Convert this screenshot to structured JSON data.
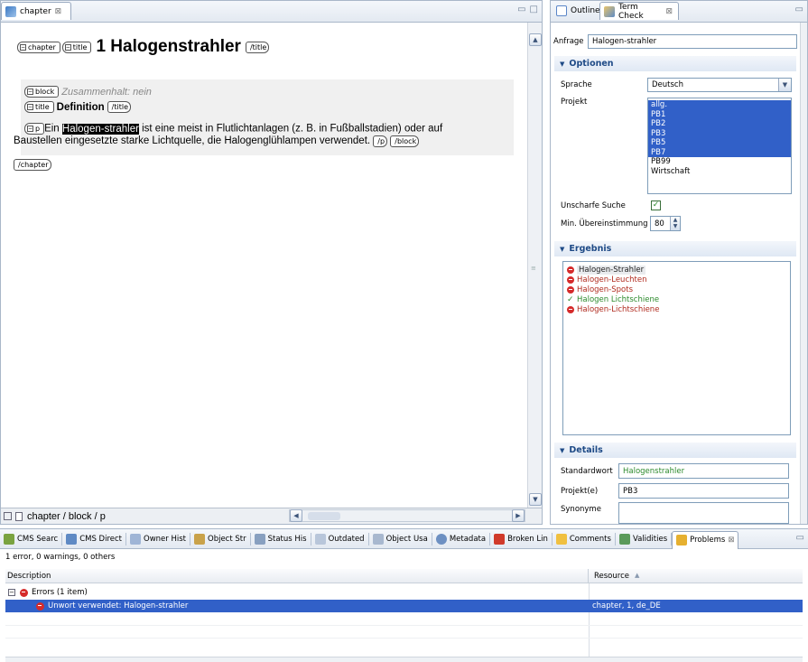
{
  "editor": {
    "tab_label": "chapter",
    "tab_close": "⊠",
    "tags": {
      "chapter": "chapter",
      "title": "title",
      "title_end": "/title",
      "block": "block",
      "p": "p",
      "p_end": "/p",
      "block_end": "/block",
      "chapter_end": "/chapter"
    },
    "heading": "1 Halogenstrahler",
    "meta_text": "Zusammenhalt: nein",
    "subheading": "Definition",
    "para_before": "Ein ",
    "para_highlight": "Halogen-strahler",
    "para_line1_after": " ist eine meist in Flutlichtanlagen (z. B. in Fußballstadien) oder auf",
    "para_line2": "Baustellen eingesetzte starke Lichtquelle, die Halogenglühlampen verwendet.",
    "breadcrumb": "chapter / block / p"
  },
  "side": {
    "tabs": [
      {
        "label": "Outline"
      },
      {
        "label": "Term Check"
      }
    ],
    "anfrage_label": "Anfrage",
    "anfrage_value": "Halogen-strahler",
    "optionen_title": "Optionen",
    "sprache_label": "Sprache",
    "sprache_value": "Deutsch",
    "projekt_label": "Projekt",
    "projekt_options": [
      "allg.",
      "PB1",
      "PB2",
      "PB3",
      "PB5",
      "PB7",
      "PB99",
      "Wirtschaft"
    ],
    "projekt_selected_count": 6,
    "unscharfe_label": "Unscharfe Suche",
    "unscharfe_checked": true,
    "min_label": "Min. Übereinstimmung",
    "min_value": "80",
    "ergebnis_title": "Ergebnis",
    "results": [
      {
        "label": "Halogen-Strahler",
        "status": "error"
      },
      {
        "label": "Halogen-Leuchten",
        "status": "error"
      },
      {
        "label": "Halogen-Spots",
        "status": "error"
      },
      {
        "label": "Halogen Lichtschiene",
        "status": "ok"
      },
      {
        "label": "Halogen-Lichtschiene",
        "status": "error"
      }
    ],
    "details_title": "Details",
    "standardwort_label": "Standardwort",
    "standardwort_value": "Halogenstrahler",
    "projekte_label": "Projekt(e)",
    "projekte_value": "PB3",
    "synonyme_label": "Synonyme",
    "colors": {
      "error": "#c0392b",
      "ok": "#2c8a2c",
      "selection": "#3160c8",
      "section": "#1e4a86"
    }
  },
  "problems": {
    "tabs": [
      "CMS Searc",
      "CMS Direct",
      "Owner Hist",
      "Object Str",
      "Status His",
      "Outdated",
      "Object Usa",
      "Metadata",
      "Broken Lin",
      "Comments",
      "Validities",
      "Problems"
    ],
    "summary": "1 error, 0 warnings, 0 others",
    "col_description": "Description",
    "col_resource": "Resource",
    "group_label": "Errors (1 item)",
    "error_description": "Unwort verwendet: Halogen-strahler",
    "error_resource": "chapter, 1, de_DE"
  }
}
